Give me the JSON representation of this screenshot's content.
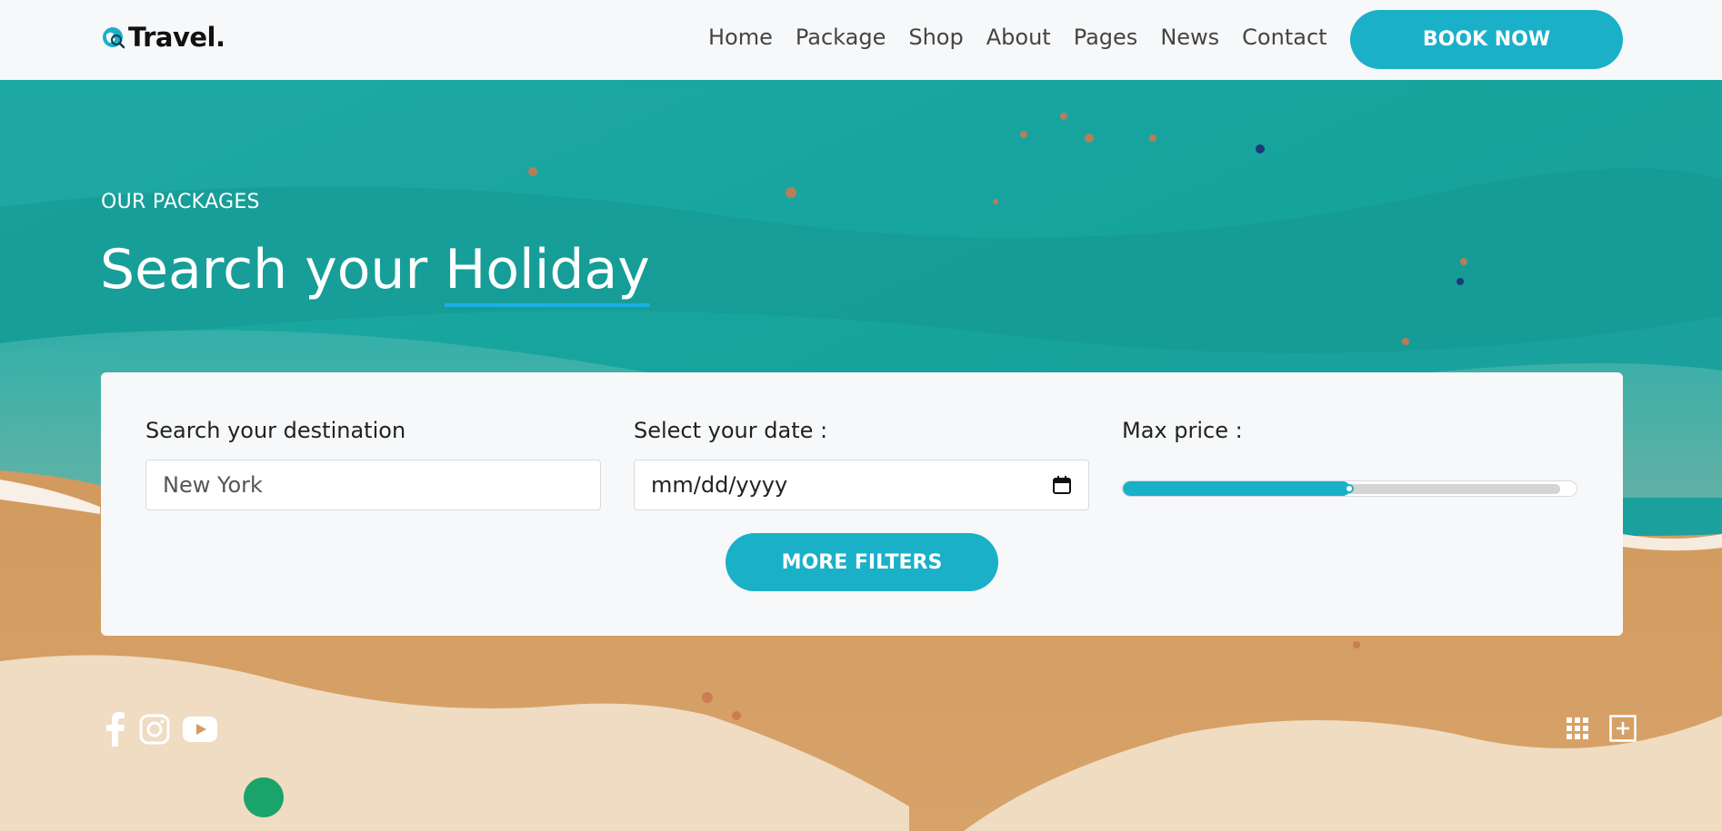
{
  "header": {
    "logo_text": "Travel.",
    "nav": [
      "Home",
      "Package",
      "Shop",
      "About",
      "Pages",
      "News",
      "Contact"
    ],
    "book_label": "BOOK NOW"
  },
  "hero": {
    "eyebrow": "OUR PACKAGES",
    "title_prefix": "Search your ",
    "title_highlight": "Holiday"
  },
  "search": {
    "destination_label": "Search your destination",
    "destination_placeholder": "New York",
    "date_label": "Select your date :",
    "date_placeholder": "mm/dd/yyyy",
    "price_label": "Max price :",
    "price_level": 0.5,
    "more_filters_label": "MORE FILTERS"
  },
  "socials": [
    "facebook-icon",
    "instagram-icon",
    "youtube-icon"
  ],
  "corner_icons": [
    "grid-icon",
    "plus-square-icon"
  ],
  "colors": {
    "accent": "#1ab0c8",
    "header_bg": "#f7f8f9",
    "sea": "#1aa6a0",
    "sand": "#d9a56c"
  }
}
